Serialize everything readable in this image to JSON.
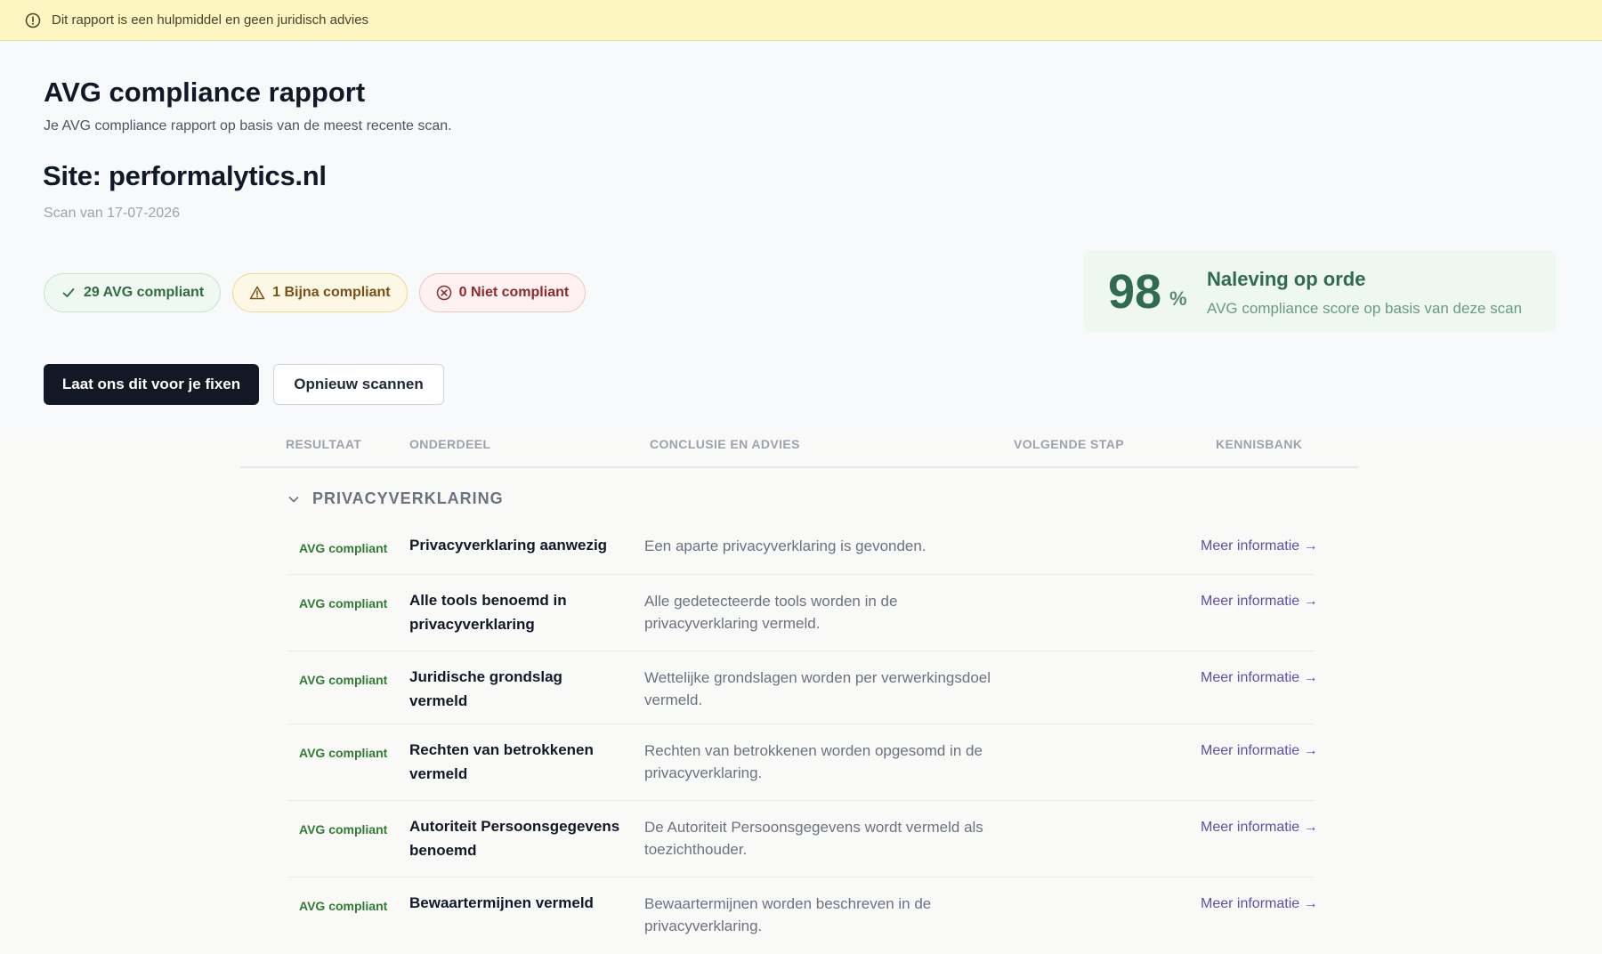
{
  "banner": {
    "text": "Dit rapport is een hulpmiddel en geen juridisch advies",
    "icon": "info-circle-icon"
  },
  "header": {
    "title": "AVG compliance rapport",
    "subtitle": "Je AVG compliance rapport op basis van de meest recente scan.",
    "site": "Site: performalytics.nl",
    "scan_date": "Scan van 17-07-2026"
  },
  "summary": {
    "compliant": "29 AVG compliant",
    "almost": "1 Bijna compliant",
    "non_compliant": "0 Niet compliant"
  },
  "score": {
    "value": "98",
    "unit": "%",
    "title": "Naleving op orde",
    "description": "AVG compliance score op basis van deze scan"
  },
  "actions": {
    "fix_label": "Laat ons dit voor je fixen",
    "rescan_label": "Opnieuw scannen"
  },
  "table": {
    "columns": [
      "RESULTAAT",
      "ONDERDEEL",
      "CONCLUSIE EN ADVIES",
      "VOLGENDE STAP",
      "KENNISBANK"
    ],
    "section_title": "PRIVACYVERKLARING",
    "rows": [
      {
        "status": "AVG compliant",
        "title": "Privacyverklaring aanwezig",
        "description": "Een aparte privacyverklaring is gevonden.",
        "link": "Meer informatie →"
      },
      {
        "status": "AVG compliant",
        "title": "Alle tools benoemd in privacyverklaring",
        "description": "Alle gedetecteerde tools worden in de privacyverklaring vermeld.",
        "link": "Meer informatie →"
      },
      {
        "status": "AVG compliant",
        "title": "Juridische grondslag vermeld",
        "description": "Wettelijke grondslagen worden per verwerkingsdoel vermeld.",
        "link": "Meer informatie →"
      },
      {
        "status": "AVG compliant",
        "title": "Rechten van betrokkenen vermeld",
        "description": "Rechten van betrokkenen worden opgesomd in de privacyverklaring.",
        "link": "Meer informatie →"
      },
      {
        "status": "AVG compliant",
        "title": "Autoriteit Persoonsgegevens benoemd",
        "description": "De Autoriteit Persoonsgegevens wordt vermeld als toezichthouder.",
        "link": "Meer informatie →"
      },
      {
        "status": "AVG compliant",
        "title": "Bewaartermijnen vermeld",
        "description": "Bewaartermijnen worden beschreven in de privacyverklaring.",
        "link": "Meer informatie →"
      }
    ]
  }
}
